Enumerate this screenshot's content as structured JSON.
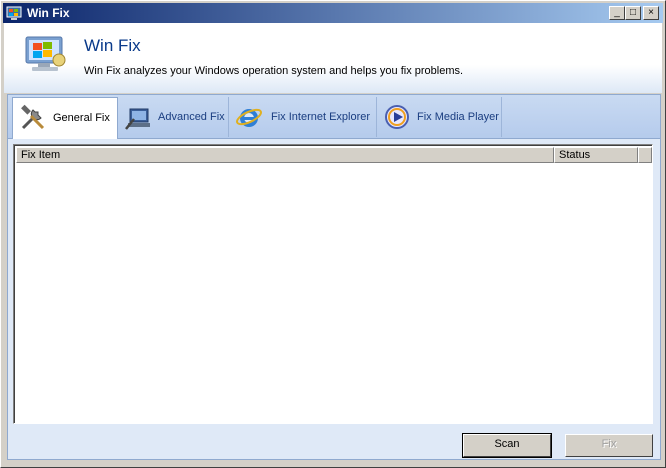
{
  "window": {
    "title": "Win Fix"
  },
  "titlebar": {
    "minimize": "_",
    "maximize": "□",
    "close": "×"
  },
  "header": {
    "title": "Win Fix",
    "subtitle": "Win Fix analyzes your Windows operation system and helps you fix problems."
  },
  "tabs": [
    {
      "label": "General Fix",
      "icon": "tools-icon",
      "active": true
    },
    {
      "label": "Advanced Fix",
      "icon": "computer-tools-icon",
      "active": false
    },
    {
      "label": "Fix Internet Explorer",
      "icon": "internet-explorer-icon",
      "active": false
    },
    {
      "label": "Fix Media Player",
      "icon": "media-player-icon",
      "active": false
    }
  ],
  "table": {
    "columns": [
      "Fix Item",
      "Status"
    ],
    "rows": []
  },
  "buttons": {
    "scan": "Scan",
    "fix": "Fix"
  }
}
